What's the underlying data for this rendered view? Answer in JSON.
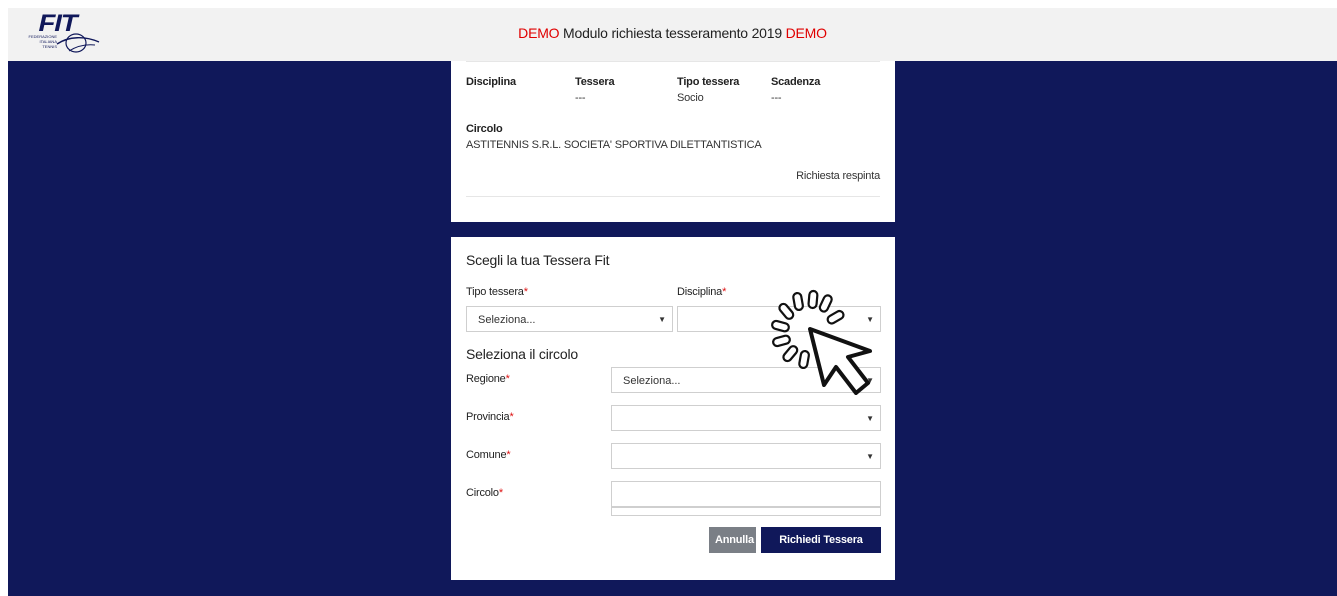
{
  "header": {
    "demo_prefix": "DEMO",
    "title": " Modulo richiesta tesseramento 2019 ",
    "demo_suffix": "DEMO",
    "logo_text": "FIT",
    "logo_subtext_1": "FEDERAZIONE",
    "logo_subtext_2": "ITALIANA",
    "logo_subtext_3": "TENNIS"
  },
  "current": {
    "columns": [
      {
        "label": "Disciplina",
        "value": ""
      },
      {
        "label": "Tessera",
        "value": "---"
      },
      {
        "label": "Tipo tessera",
        "value": "Socio"
      },
      {
        "label": "Scadenza",
        "value": "---"
      }
    ],
    "circolo_label": "Circolo",
    "circolo_value": "ASTITENNIS S.R.L. SOCIETA' SPORTIVA DILETTANTISTICA",
    "status": "Richiesta respinta"
  },
  "form": {
    "title": "Scegli la tua Tessera Fit",
    "tipo_label": "Tipo tessera",
    "tipo_value": "Seleziona...",
    "disciplina_label": "Disciplina",
    "disciplina_value": "",
    "circolo_section": "Seleziona il circolo",
    "regione_label": "Regione",
    "regione_value": "Seleziona...",
    "provincia_label": "Provincia",
    "provincia_value": "",
    "comune_label": "Comune",
    "comune_value": "",
    "circolo_label": "Circolo",
    "circolo_value": "",
    "required_mark": "*",
    "cancel_label": "Annulla",
    "submit_label": "Richiedi Tessera"
  },
  "colors": {
    "background": "#10185a",
    "demo": "#e00000",
    "required": "#d11111",
    "primary_button": "#10185a",
    "cancel_button": "#7a7f86"
  },
  "icons": [
    "fit-logo-icon",
    "dropdown-arrow-icon",
    "loading-cursor-icon"
  ]
}
